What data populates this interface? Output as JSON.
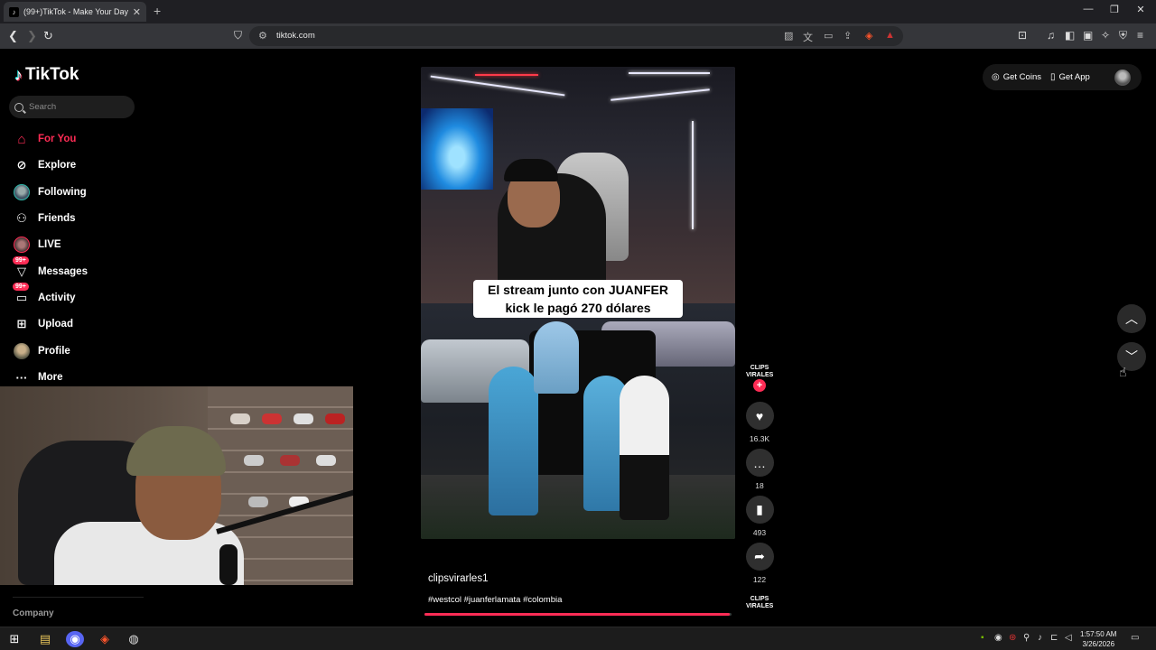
{
  "browser": {
    "tab_title": "(99+)TikTok - Make Your Day",
    "tab_close": "✕",
    "new_tab": "+",
    "url": "tiktok.com",
    "window_controls": [
      "—",
      "❐",
      "✕"
    ]
  },
  "sidebar": {
    "logo": "TikTok",
    "search_placeholder": "Search",
    "items": [
      {
        "label": "For You",
        "icon": "home-icon",
        "active": true
      },
      {
        "label": "Explore",
        "icon": "compass-icon"
      },
      {
        "label": "Following",
        "icon": "following-avatar-icon"
      },
      {
        "label": "Friends",
        "icon": "friends-icon"
      },
      {
        "label": "LIVE",
        "icon": "live-avatar-icon"
      },
      {
        "label": "Messages",
        "icon": "messages-icon",
        "badge": "99+"
      },
      {
        "label": "Activity",
        "icon": "activity-icon",
        "badge": "99+"
      },
      {
        "label": "Upload",
        "icon": "upload-icon"
      },
      {
        "label": "Profile",
        "icon": "profile-avatar-icon"
      },
      {
        "label": "More",
        "icon": "more-icon"
      }
    ],
    "footer": "Company"
  },
  "video": {
    "caption_line1": "El stream junto con JUANFER",
    "caption_line2": "kick le pagó 270 dólares",
    "author": "clipsvirarles1",
    "hashtags": "#westcol #juanferlamata #colombia",
    "progress": 0.995
  },
  "actions": {
    "channel_logo": "CLIPS VIRALES",
    "likes": "16.3K",
    "comments": "18",
    "saves": "493",
    "shares": "122"
  },
  "topright": {
    "get_coins": "Get Coins",
    "get_app": "Get App"
  },
  "taskbar": {
    "time": "1:57:50 AM",
    "date": "3/26/2026"
  },
  "colors": {
    "accent": "#fe2c55",
    "background": "#000000"
  }
}
